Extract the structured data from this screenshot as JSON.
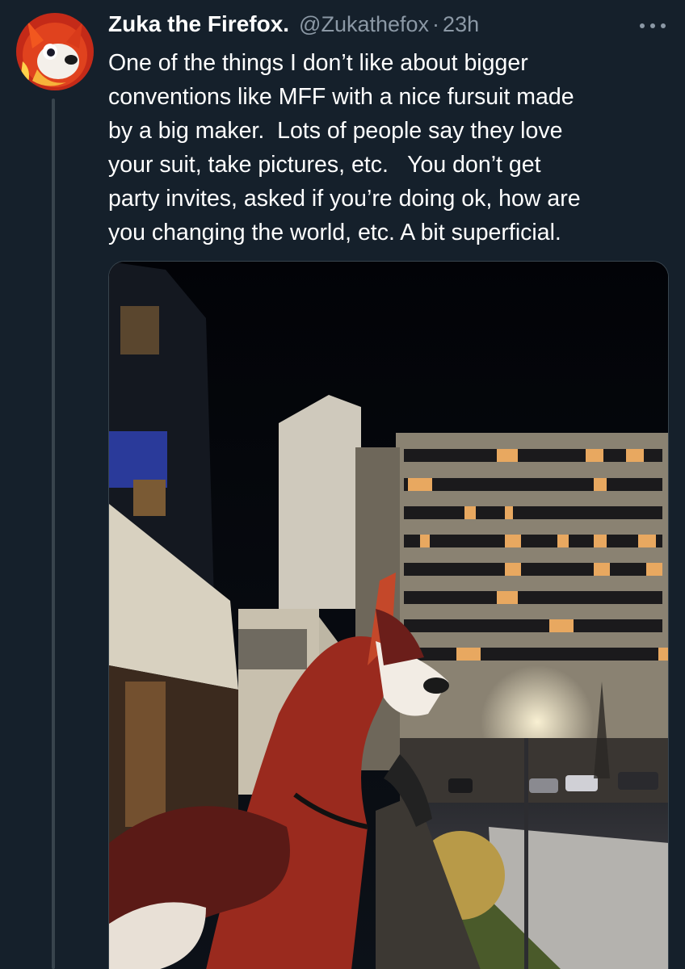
{
  "tweet": {
    "author": {
      "display_name": "Zuka the Firefox.",
      "handle": "@Zukathefox",
      "separator": "·",
      "time": "23h",
      "avatar_icon": "fox-avatar-icon"
    },
    "more_icon": "more-horizontal-icon",
    "text_lines": [
      "One of the things I don’t like about bigger",
      "conventions like MFF with a nice fursuit made",
      "by a big maker.  Lots of people say they love",
      "your suit, take pictures, etc.   You don’t get",
      "party invites, asked if you’re doing ok, how are",
      "you changing the world, etc. A bit superficial."
    ],
    "media": {
      "description_icon": "photo-fursuit-night-hotel"
    }
  },
  "colors": {
    "background": "#15202b",
    "primary_text": "#ffffff",
    "secondary_text": "#8b98a5",
    "thread_line": "#38444d"
  }
}
